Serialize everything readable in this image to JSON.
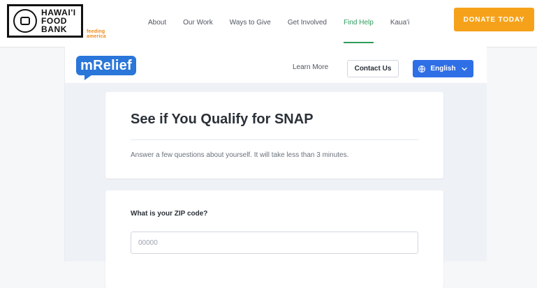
{
  "header": {
    "logo_text": "HAWAI'I\nFOOD\nBANK",
    "partner_badge_text": "feeding america",
    "nav_items": [
      {
        "label": "About"
      },
      {
        "label": "Our Work"
      },
      {
        "label": "Ways to Give"
      },
      {
        "label": "Get Involved"
      },
      {
        "label": "Find Help",
        "active": true
      },
      {
        "label": "Kaua'i"
      }
    ],
    "donate_label": "DONATE TODAY",
    "accent_colors": {
      "donate_bg": "#f5a21a",
      "active_nav": "#2f9b5d"
    }
  },
  "mrelief": {
    "logo_text": "mRelief",
    "learn_more": "Learn More",
    "contact_us": "Contact Us",
    "language": "English",
    "icons": {
      "globe": "globe-icon",
      "chevron": "chevron-down-icon"
    },
    "colors": {
      "brand_blue": "#2a76d9",
      "language_button": "#2f6fe6"
    }
  },
  "snap_card": {
    "title": "See if You Qualify for SNAP",
    "subtitle": "Answer a few questions about yourself. It will take less than 3 minutes."
  },
  "zip_card": {
    "label": "What is your ZIP code?",
    "placeholder": "00000",
    "value": ""
  }
}
